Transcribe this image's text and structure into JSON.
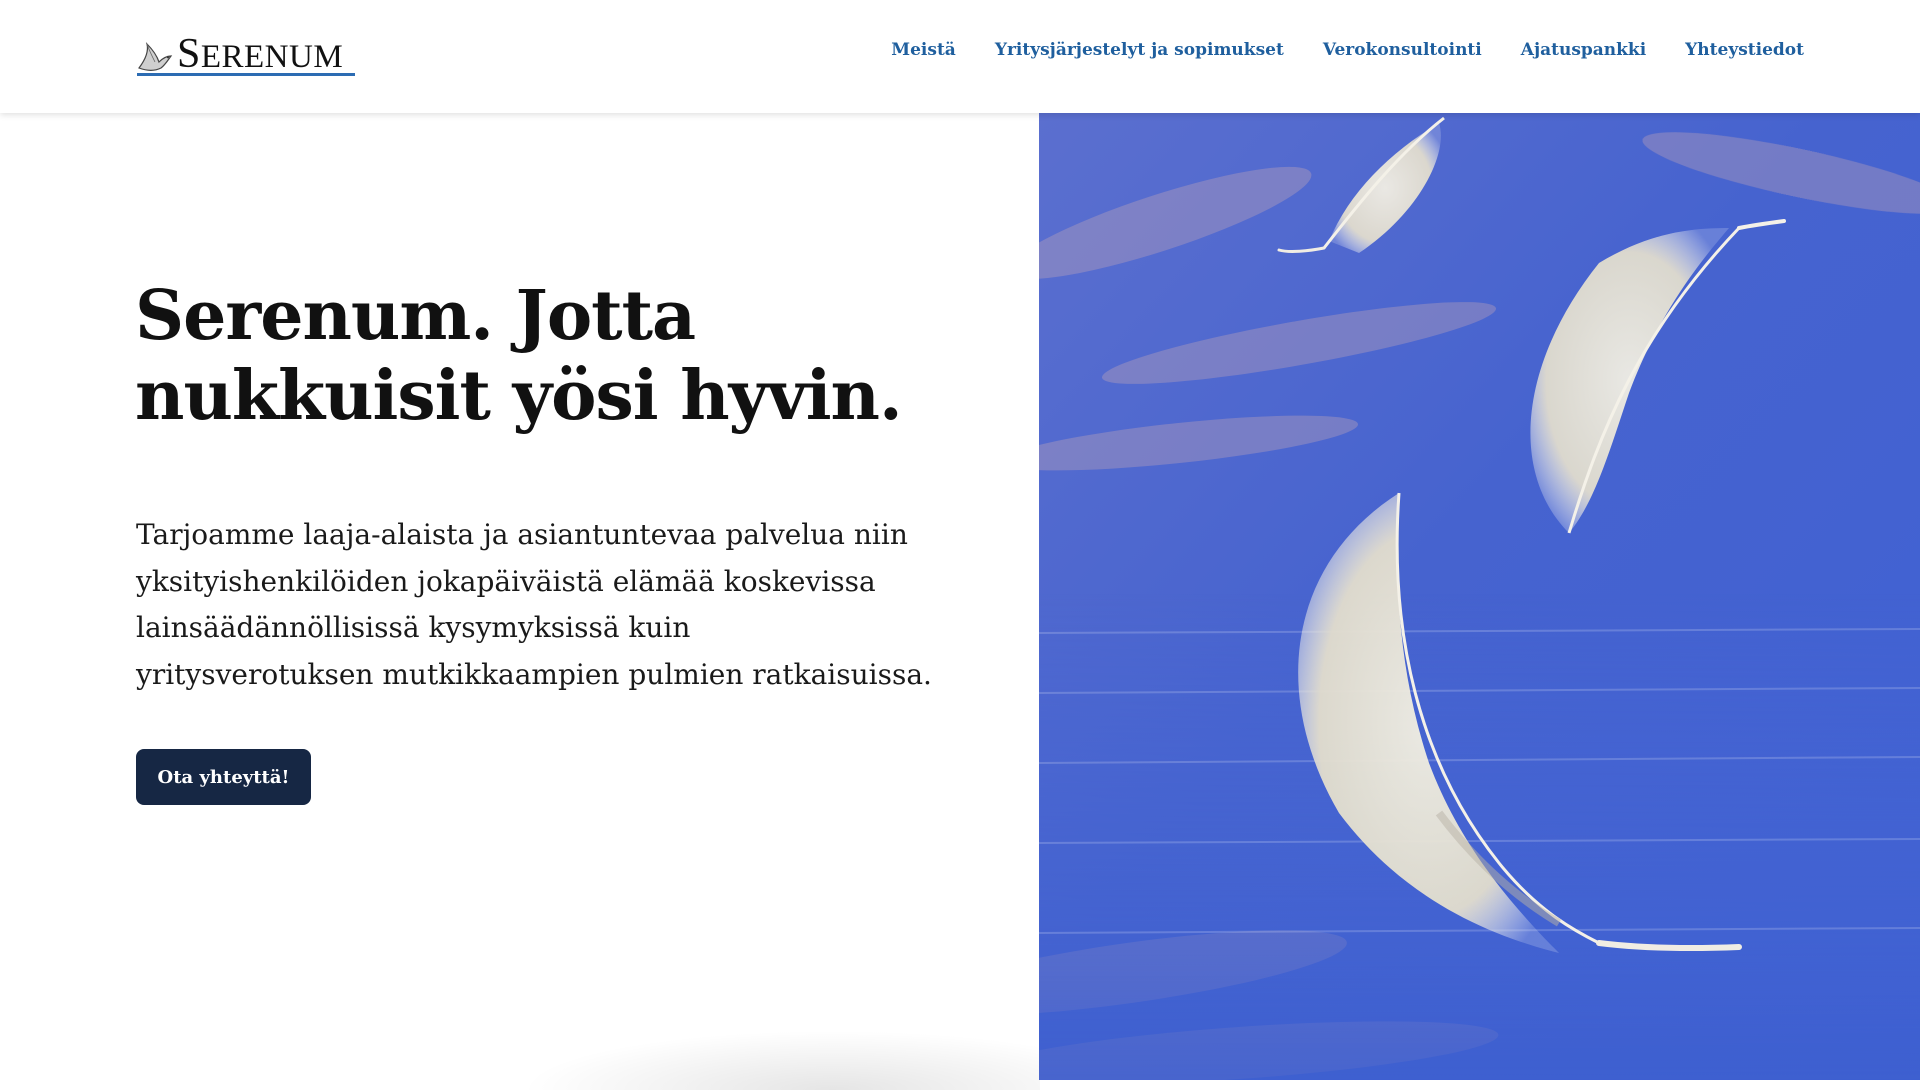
{
  "header": {
    "logo_text": "Serenum",
    "nav": [
      {
        "label": "Meistä"
      },
      {
        "label": "Yritysjärjestelyt ja sopimukset"
      },
      {
        "label": "Verokonsultointi"
      },
      {
        "label": "Ajatuspankki"
      },
      {
        "label": "Yhteystiedot"
      }
    ]
  },
  "hero": {
    "headline_line1": "Serenum. Jotta",
    "headline_line2": "nukkuisit yösi hyvin.",
    "intro": "Tarjoamme laaja-alaista ja asiantuntevaa palvelua niin yksityishenkilöiden jokapäiväistä elämää koskevissa lainsäädännöllisissä kysymyksissä kuin yritysverotuksen mutkikkaampien pulmien ratkaisuissa.",
    "cta_label": "Ota yhteyttä!"
  },
  "colors": {
    "nav_link": "#1f5f9e",
    "cta_bg": "#162744",
    "logo_underline": "#2c6cb3",
    "sky_blue": "#4a6bd1"
  },
  "image": {
    "subject": "feathers-over-sky"
  }
}
